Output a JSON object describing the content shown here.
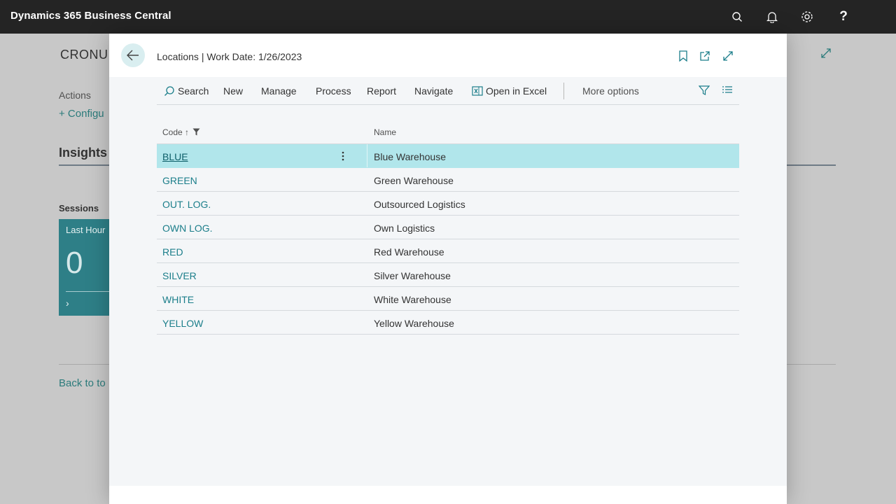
{
  "app": {
    "title": "Dynamics 365 Business Central",
    "icons": [
      "search-icon",
      "bell-icon",
      "gear-icon",
      "help-icon"
    ]
  },
  "background": {
    "company": "CRONU",
    "actions_label": "Actions",
    "configure_label": "+ Configu",
    "insights_label": "Insights",
    "sessions_label": "Sessions",
    "tile_title": "Last Hour",
    "tile_value": "0",
    "back_label": "Back to to"
  },
  "dialog": {
    "title": "Locations | Work Date: 1/26/2023",
    "actions": {
      "search": "Search",
      "new": "New",
      "manage": "Manage",
      "process": "Process",
      "report": "Report",
      "navigate": "Navigate",
      "open_in_excel": "Open in Excel",
      "more_options": "More options"
    },
    "columns": {
      "code": "Code",
      "name": "Name"
    },
    "rows": [
      {
        "code": "BLUE",
        "name": "Blue Warehouse"
      },
      {
        "code": "GREEN",
        "name": "Green Warehouse"
      },
      {
        "code": "OUT. LOG.",
        "name": "Outsourced Logistics"
      },
      {
        "code": "OWN LOG.",
        "name": "Own Logistics"
      },
      {
        "code": "RED",
        "name": "Red Warehouse"
      },
      {
        "code": "SILVER",
        "name": "Silver Warehouse"
      },
      {
        "code": "WHITE",
        "name": "White Warehouse"
      },
      {
        "code": "YELLOW",
        "name": "Yellow Warehouse"
      }
    ],
    "selected_row": "BLUE"
  },
  "colors": {
    "topbar": "#242424",
    "accent": "#1b7e8a",
    "selected_row": "#b1e6eb"
  }
}
